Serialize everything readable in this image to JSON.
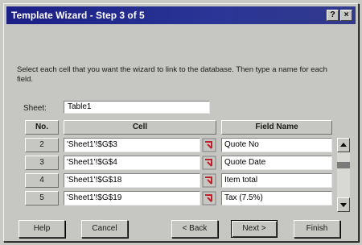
{
  "window": {
    "title": "Template Wizard - Step 3 of 5",
    "help_button": "?",
    "close_button": "×"
  },
  "instructions": "Select each cell that you want the wizard to link to the database. Then type a name for each field.",
  "sheet": {
    "label": "Sheet:",
    "value": "Table1"
  },
  "grid": {
    "headers": {
      "no": "No.",
      "cell": "Cell",
      "field": "Field Name"
    },
    "rows": [
      {
        "no": "2",
        "cell": "'Sheet1'!$G$3",
        "field": "Quote No"
      },
      {
        "no": "3",
        "cell": "'Sheet1'!$G$4",
        "field": "Quote Date"
      },
      {
        "no": "4",
        "cell": "'Sheet1'!$G$18",
        "field": "Item total"
      },
      {
        "no": "5",
        "cell": "'Sheet1'!$G$19",
        "field": "Tax (7.5%)"
      }
    ]
  },
  "buttons": {
    "help": "Help",
    "cancel": "Cancel",
    "back": "< Back",
    "next": "Next >",
    "finish": "Finish"
  }
}
